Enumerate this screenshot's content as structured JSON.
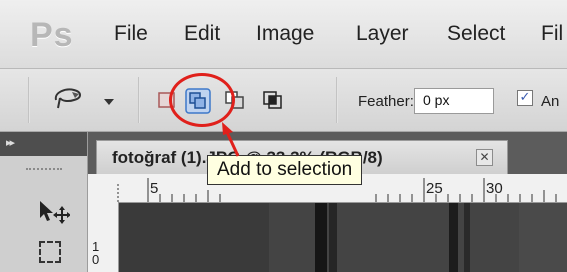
{
  "app": {
    "logo_text": "Ps"
  },
  "menu": {
    "items": [
      "File",
      "Edit",
      "Image",
      "Layer",
      "Select",
      "Fil"
    ]
  },
  "options_bar": {
    "feather_label": "Feather:",
    "feather_value": "0 px",
    "antialias_checked": true,
    "antialias_label": "An"
  },
  "document": {
    "tab_title": "fotoğraf (1).JPG @ 33,3% (RGB/8)",
    "close_glyph": "✕"
  },
  "rulers": {
    "horizontal_ticks": [
      "5",
      "25",
      "30"
    ],
    "vertical_label": "1 0"
  },
  "tooltip": {
    "text": "Add to selection"
  },
  "panel": {
    "collapse_glyph": "▸▸"
  },
  "colors": {
    "annotation": "#e0201b",
    "tooltip_bg": "#ffffe1",
    "active_button": "#3d78c9"
  }
}
